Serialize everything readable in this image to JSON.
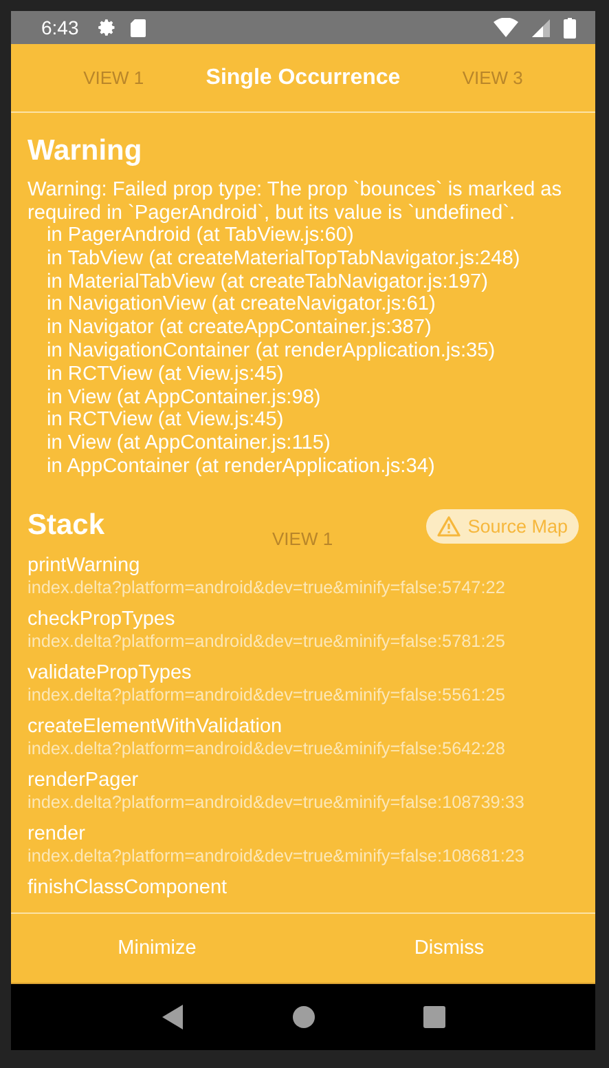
{
  "status_bar": {
    "time": "6:43"
  },
  "background_tabs": [
    "VIEW 1",
    "VIEW 3"
  ],
  "background_label": "VIEW 1",
  "header": {
    "title": "Single Occurrence"
  },
  "warning": {
    "title": "Warning",
    "message": "Warning: Failed prop type: The prop `bounces` is marked as required in `PagerAndroid`, but its value is `undefined`.",
    "component_stack": [
      "in PagerAndroid (at TabView.js:60)",
      "in TabView (at createMaterialTopTabNavigator.js:248)",
      "in MaterialTabView (at createTabNavigator.js:197)",
      "in NavigationView (at createNavigator.js:61)",
      "in Navigator (at createAppContainer.js:387)",
      "in NavigationContainer (at renderApplication.js:35)",
      "in RCTView (at View.js:45)",
      "in View (at AppContainer.js:98)",
      "in RCTView (at View.js:45)",
      "in View (at AppContainer.js:115)",
      "in AppContainer (at renderApplication.js:34)"
    ]
  },
  "stack": {
    "title": "Stack",
    "source_map_button": "Source Map",
    "frames": [
      {
        "name": "printWarning",
        "location": "index.delta?platform=android&dev=true&minify=false:5747:22"
      },
      {
        "name": "checkPropTypes",
        "location": "index.delta?platform=android&dev=true&minify=false:5781:25"
      },
      {
        "name": "validatePropTypes",
        "location": "index.delta?platform=android&dev=true&minify=false:5561:25"
      },
      {
        "name": "createElementWithValidation",
        "location": "index.delta?platform=android&dev=true&minify=false:5642:28"
      },
      {
        "name": "renderPager",
        "location": "index.delta?platform=android&dev=true&minify=false:108739:33"
      },
      {
        "name": "render",
        "location": "index.delta?platform=android&dev=true&minify=false:108681:23"
      },
      {
        "name": "finishClassComponent"
      }
    ]
  },
  "buttons": [
    "Minimize",
    "Dismiss"
  ]
}
